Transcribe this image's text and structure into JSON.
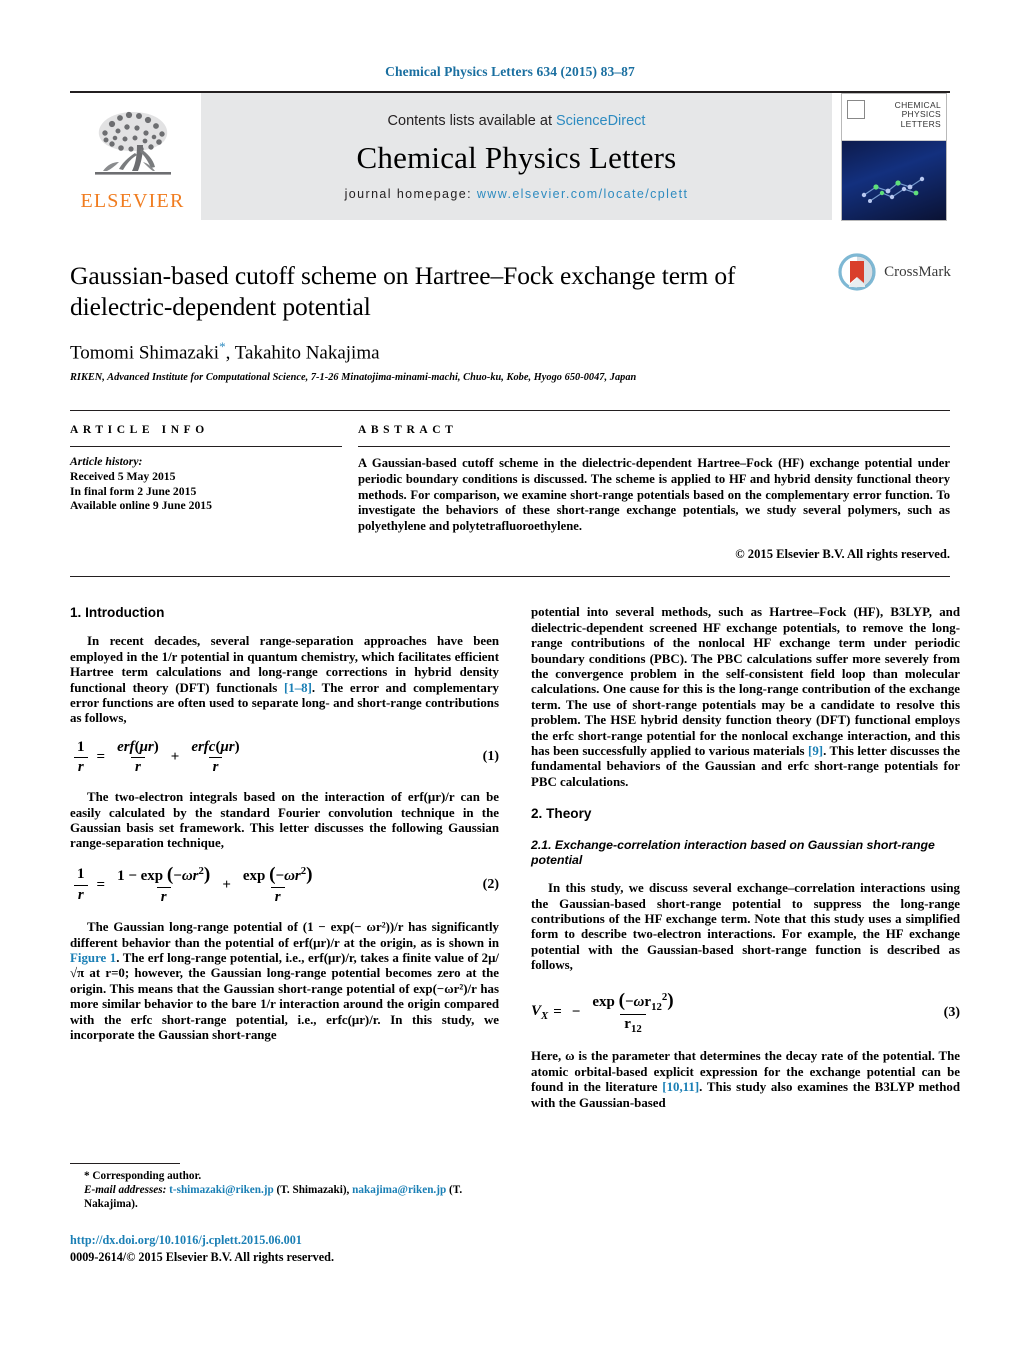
{
  "running_head": "Chemical Physics Letters 634 (2015) 83–87",
  "masthead": {
    "publisher_logo_text": "ELSEVIER",
    "contents_prefix": "Contents lists available at ",
    "contents_link": "ScienceDirect",
    "journal_title": "Chemical Physics Letters",
    "homepage_prefix": "journal homepage: ",
    "homepage_url": "www.elsevier.com/locate/cplett",
    "cover_title_lines": [
      "CHEMICAL",
      "PHYSICS",
      "LETTERS"
    ]
  },
  "article": {
    "title": "Gaussian-based cutoff scheme on Hartree–Fock exchange term of dielectric-dependent potential",
    "authors": "Tomomi Shimazaki",
    "author_marker": "*",
    "authors_rest": ", Takahito Nakajima",
    "affiliation": "RIKEN, Advanced Institute for Computational Science, 7-1-26 Minatojima-minami-machi, Chuo-ku, Kobe, Hyogo 650-0047, Japan",
    "crossmark_label": "CrossMark"
  },
  "info": {
    "heading": "ARTICLE INFO",
    "history_label": "Article history:",
    "history": [
      "Received 5 May 2015",
      "In final form 2 June 2015",
      "Available online 9 June 2015"
    ]
  },
  "abstract": {
    "heading": "ABSTRACT",
    "text": "A Gaussian-based cutoff scheme in the dielectric-dependent Hartree–Fock (HF) exchange potential under periodic boundary conditions is discussed. The scheme is applied to HF and hybrid density functional theory methods. For comparison, we examine short-range potentials based on the complementary error function. To investigate the behaviors of these short-range exchange potentials, we study several polymers, such as polyethylene and polytetrafluoroethylene.",
    "copyright": "© 2015 Elsevier B.V. All rights reserved."
  },
  "sections": {
    "intro_heading": "1. Introduction",
    "theory_heading": "2. Theory",
    "theory_sub_heading": "2.1. Exchange-correlation interaction based on Gaussian short-range potential"
  },
  "paragraphs": {
    "intro_p1_a": "In recent decades, several range-separation approaches have been employed in the 1/r potential in quantum chemistry, which facilitates efficient Hartree term calculations and long-range corrections in hybrid density functional theory (DFT) functionals ",
    "intro_p1_ref": "[1–8]",
    "intro_p1_b": ". The error and complementary error functions are often used to separate long- and short-range contributions as follows,",
    "intro_p2": "The two-electron integrals based on the interaction of erf(μr)/r can be easily calculated by the standard Fourier convolution technique in the Gaussian basis set framework. This letter discusses the following Gaussian range-separation technique,",
    "intro_p3_a": "The Gaussian long-range potential of (1 − exp(− ωr²))/r has significantly different behavior than the potential of erf(μr)/r at the origin, as is shown in ",
    "intro_p3_fig": "Figure 1",
    "intro_p3_b": ". The erf long-range potential, i.e., erf(μr)/r, takes a finite value of 2μ/√π at r=0; however, the Gaussian long-range potential becomes zero at the origin. This means that the Gaussian short-range potential of exp(−ωr²)/r has more similar behavior to the bare 1/r interaction around the origin compared with the erfc short-range potential, i.e., erfc(μr)/r. In this study, we incorporate the Gaussian short-range",
    "right_p1_a": "potential into several methods, such as Hartree–Fock (HF), B3LYP, and dielectric-dependent screened HF exchange potentials, to remove the long-range contributions of the nonlocal HF exchange term under periodic boundary conditions (PBC). The PBC calculations suffer more severely from the convergence problem in the self-consistent field loop than molecular calculations. One cause for this is the long-range contribution of the exchange term. The use of short-range potentials may be a candidate to resolve this problem. The HSE hybrid density function theory (DFT) functional employs the erfc short-range potential for the nonlocal exchange interaction, and this has been successfully applied to various materials ",
    "right_p1_ref": "[9]",
    "right_p1_b": ". This letter discusses the fundamental behaviors of the Gaussian and erfc short-range potentials for PBC calculations.",
    "theory_p1": "In this study, we discuss several exchange–correlation interactions using the Gaussian-based short-range potential to suppress the long-range contributions of the HF exchange term. Note that this study uses a simplified form to describe two-electron interactions. For example, the HF exchange potential with the Gaussian-based short-range function is described as follows,",
    "theory_p2_a": "Here, ω is the parameter that determines the decay rate of the potential. The atomic orbital-based explicit expression for the exchange potential can be found in the literature ",
    "theory_p2_ref": "[10,11]",
    "theory_p2_b": ". This study also examines the B3LYP method with the Gaussian-based"
  },
  "equations": {
    "eq1_number": "(1)",
    "eq2_number": "(2)",
    "eq3_number": "(3)",
    "eq1_text": "1/r = erf(μr)/r + erfc(μr)/r",
    "eq2_text": "1/r = (1 − exp(−ωr²))/r + exp(−ωr²)/r",
    "eq3_text": "VX = − exp(−ωr₁₂²)/r₁₂"
  },
  "footnotes": {
    "corresponding": "* Corresponding author.",
    "email_label": "E-mail addresses:",
    "email1": "t-shimazaki@riken.jp",
    "email1_who": " (T. Shimazaki), ",
    "email2": "nakajima@riken.jp",
    "email2_who": " (T. Nakajima).",
    "doi": "http://dx.doi.org/10.1016/j.cplett.2015.06.001",
    "issn": "0009-2614/© 2015 Elsevier B.V. All rights reserved."
  },
  "colors": {
    "link": "#1a7fb5",
    "header_blue": "#1a6fa0",
    "elsevier_orange": "#f07c1f",
    "masthead_grey": "#e6e7e8"
  }
}
